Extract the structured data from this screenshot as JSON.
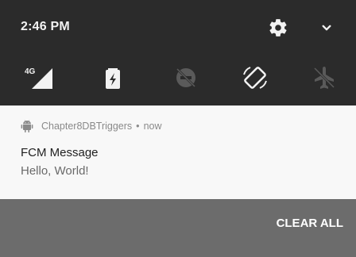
{
  "status_bar": {
    "time": "2:46 PM"
  },
  "header_icons": {
    "settings": "gear-icon",
    "expand": "chevron-down-icon"
  },
  "quick_settings": [
    {
      "name": "mobile-data-4g",
      "label": "4G"
    },
    {
      "name": "battery-saver"
    },
    {
      "name": "do-not-disturb"
    },
    {
      "name": "auto-rotate"
    },
    {
      "name": "airplane-mode"
    }
  ],
  "notification": {
    "app_name": "Chapter8DBTriggers",
    "separator": "•",
    "time": "now",
    "title": "FCM Message",
    "body": "Hello, World!"
  },
  "actions": {
    "clear_all_label": "CLEAR ALL"
  },
  "colors": {
    "shade": "#2b2b2b",
    "card": "#f8f8f8",
    "clear_bar": "#6c6c6c"
  }
}
